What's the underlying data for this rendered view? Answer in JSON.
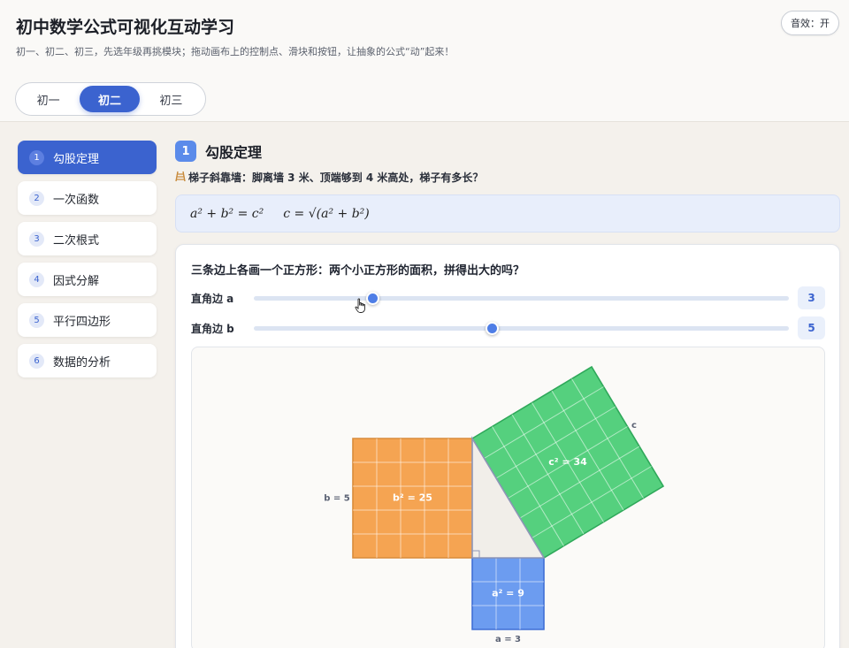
{
  "header": {
    "title": "初中数学公式可视化互动学习",
    "subtitle": "初一、初二、初三，先选年级再挑模块；拖动画布上的控制点、滑块和按钮，让抽象的公式“动”起来！",
    "sound_button": "音效：开"
  },
  "grades": [
    {
      "label": "初一",
      "active": false
    },
    {
      "label": "初二",
      "active": true
    },
    {
      "label": "初三",
      "active": false
    }
  ],
  "sidebar": {
    "items": [
      {
        "num": "1",
        "label": "勾股定理",
        "active": true
      },
      {
        "num": "2",
        "label": "一次函数",
        "active": false
      },
      {
        "num": "3",
        "label": "二次根式",
        "active": false
      },
      {
        "num": "4",
        "label": "因式分解",
        "active": false
      },
      {
        "num": "5",
        "label": "平行四边形",
        "active": false
      },
      {
        "num": "6",
        "label": "数据的分析",
        "active": false
      }
    ]
  },
  "section": {
    "num": "1",
    "title": "勾股定理",
    "scenario": "梯子斜靠墙：脚离墙 3 米、顶端够到 4 米高处，梯子有多长？",
    "scenario_icon": "ladder-icon",
    "formula1": "a² + b² = c²",
    "formula2": "c = √(a² + b²)"
  },
  "card": {
    "question": "三条边上各画一个正方形：两个小正方形的面积，拼得出大的吗？",
    "sliders": [
      {
        "label": "直角边 a",
        "value": 3,
        "min": 1,
        "max": 10,
        "display": "3"
      },
      {
        "label": "直角边 b",
        "value": 5,
        "min": 1,
        "max": 10,
        "display": "5"
      }
    ]
  },
  "figure": {
    "a": 3,
    "b": 5,
    "labels": {
      "a_side": "a = 3",
      "b_side": "b = 5",
      "c_side": "c",
      "a_square": "a² = 9",
      "b_square": "b² = 25",
      "c_square": "c² = 34"
    },
    "colors": {
      "a_square": "#6c9cf0",
      "b_square": "#f5a452",
      "c_square": "#55d07e",
      "triangle": "#f1eee9",
      "accent": "#3b63cf"
    }
  }
}
